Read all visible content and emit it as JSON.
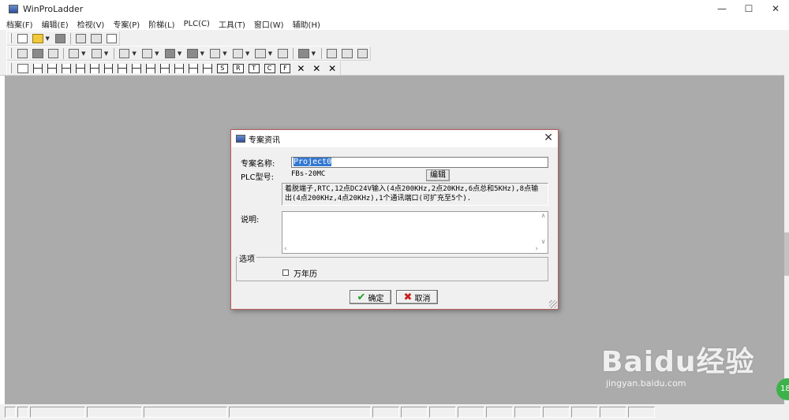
{
  "window": {
    "title": "WinProLadder",
    "min_symbol": "—",
    "max_symbol": "☐",
    "close_symbol": "✕"
  },
  "menu": [
    "档案(F)",
    "编辑(E)",
    "检视(V)",
    "专案(P)",
    "阶梯(L)",
    "PLC(C)",
    "工具(T)",
    "窗口(W)",
    "辅助(H)"
  ],
  "toolbar": {
    "row3_letters": [
      "S",
      "R",
      "T",
      "C",
      "F"
    ]
  },
  "dialog": {
    "title": "专案资讯",
    "close_symbol": "✕",
    "project_name_label": "专案名称:",
    "project_name_value": "Project0",
    "plc_model_label": "PLC型号:",
    "plc_model_value": "FBs-20MC",
    "edit_button": "编辑",
    "plc_description": "着脱端子,RTC,12点DC24V输入(4点200KHz,2点20KHz,6点总和5KHz),8点输出(4点200KHz,4点20KHz),1个通讯端口(可扩充至5个).",
    "note_label": "说明:",
    "note_value": "",
    "options_label": "选项",
    "calendar_label": "万年历",
    "calendar_checked": false,
    "ok_button": "确定",
    "cancel_button": "取消",
    "ok_icon": "✔",
    "cancel_icon": "✖"
  },
  "watermark": {
    "logo": "Baidu经验",
    "url": "jingyan.baidu.com"
  },
  "badge": {
    "text": "18"
  },
  "colors": {
    "workspace": "#ababab",
    "dialog_border": "#b75d5d",
    "selection": "#3378d2"
  }
}
